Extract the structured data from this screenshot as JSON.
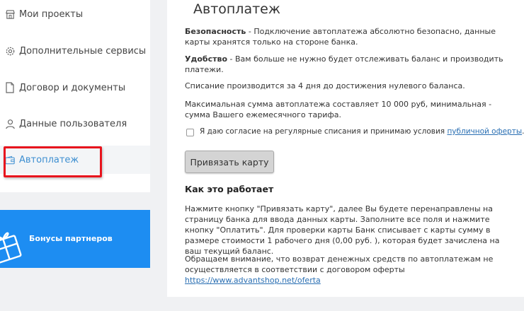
{
  "sidebar": {
    "items": [
      {
        "label": "Мои проекты",
        "icon": "shop-icon"
      },
      {
        "label": "Дополнительные сервисы",
        "icon": "gear-icon"
      },
      {
        "label": "Договор и документы",
        "icon": "document-icon"
      },
      {
        "label": "Данные пользователя",
        "icon": "user-icon"
      },
      {
        "label": "Автоплатеж",
        "icon": "wallet-icon",
        "active": true
      }
    ],
    "bonus_label": "Бонусы партнеров",
    "bonus_icon": "gift-icon"
  },
  "main": {
    "title": "Автоплатеж",
    "security_title": "Безопасность",
    "security_text": " - Подключение автоплатежа абсолютно безопасно, данные карты хранятся только на стороне банка.",
    "convenience_title": "Удобство",
    "convenience_text": " - Вам больше не нужно будет отслеживать баланс и производить платежи.",
    "debit_text": "Списание производится за 4 дня до достижения нулевого баланса.",
    "min_text": "Максимальная сумма автоплатежа составляет 10 000 руб, минимальная - сумма Вашего ежемесячного тарифа.",
    "consent_text": "Я даю согласие на регулярные списания и принимаю условия ",
    "consent_link": "публичной оферты",
    "consent_dot": ".",
    "required_mark": "*",
    "bind_button": "Привязать карту",
    "how_title": "Как это работает",
    "how_text": "Нажмите кнопку \"Привязать карту\", далее Вы будете перенаправлены на страницу банка для ввода данных карты. Заполните все поля и нажмите кнопку \"Оплатить\". Для проверки карты Банк списывает с карты сумму в размере стоимости 1 рабочего дня (0,00 руб. ), которая будет зачислена на ваш текущий баланс.",
    "refund_text": "Обращаем внимание, что возврат денежных средств по автоплатежам не осуществляется в соответствии с договором оферты ",
    "refund_link": "https://www.advantshop.net/oferta"
  },
  "colors": {
    "accent": "#3d8fd1",
    "bonus_bg": "#1d8df2",
    "highlight": "#e8141d",
    "link": "#2a6fb3"
  }
}
